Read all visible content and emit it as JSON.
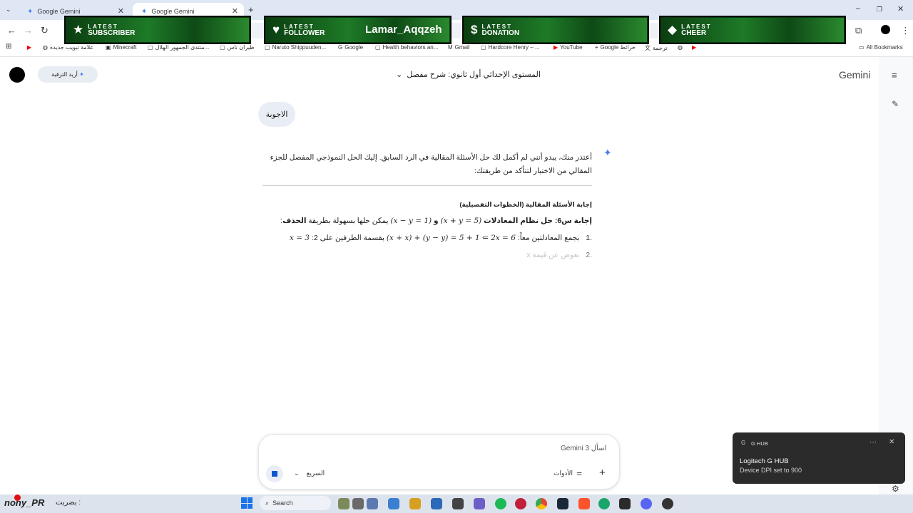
{
  "browser": {
    "tabs": [
      {
        "label": "Google Gemini",
        "active": false
      },
      {
        "label": "Google Gemini",
        "active": true
      }
    ],
    "new_tab": "+",
    "window_controls": [
      "–",
      "❐",
      "✕"
    ],
    "bookmarks": [
      {
        "icon": "youtube-icon",
        "label": ""
      },
      {
        "icon": "link-icon",
        "label": "علامة تبويب جديدة"
      },
      {
        "icon": "minecraft-icon",
        "label": "Minecraft"
      },
      {
        "icon": "page-icon",
        "label": "منتدى الجمهور الهلال..."
      },
      {
        "icon": "page-icon",
        "label": "طيران ناس"
      },
      {
        "icon": "page-icon",
        "label": "Naruto Shippuuden..."
      },
      {
        "icon": "google-icon",
        "label": "Google"
      },
      {
        "icon": "page-icon",
        "label": "Health behaviors an..."
      },
      {
        "icon": "gmail-icon",
        "label": "Gmail"
      },
      {
        "icon": "page-icon",
        "label": "Hardcore Henry – ..."
      },
      {
        "icon": "youtube-icon",
        "label": "YouTube"
      },
      {
        "icon": "maps-icon",
        "label": "Google خرائط"
      },
      {
        "icon": "translate-icon",
        "label": "ترجمة"
      },
      {
        "icon": "globe-icon",
        "label": ""
      },
      {
        "icon": "youtube-icon",
        "label": ""
      }
    ],
    "all_bookmarks": "All Bookmarks"
  },
  "stream_overlay": [
    {
      "line1": "LATEST",
      "line2": "SUBSCRIBER",
      "icon": "star-icon",
      "name": ""
    },
    {
      "line1": "LATEST",
      "line2": "FOLLOWER",
      "icon": "heart-icon",
      "name": "Lamar_Aqqzeh"
    },
    {
      "line1": "LATEST",
      "line2": "DONATION",
      "icon": "dollar-icon",
      "name": ""
    },
    {
      "line1": "LATEST",
      "line2": "CHEER",
      "icon": "diamond-icon",
      "name": ""
    }
  ],
  "gemini": {
    "brand": "Gemini",
    "conversation_title": "المستوى الإحداثي أول ثانوي: شرح مفصل",
    "upgrade_label": "أريد الترقية",
    "user_message": "الاجوبة",
    "response": {
      "intro": "أعتذر منك، يبدو أنني لم أكمل لك حل الأسئلة المقالية في الرد السابق. إليك الحل النموذجي المفصل للجزء المقالي من الاختبار لتتأكد من طريقتك:",
      "section_title": "إجابة الأسئلة المقالية (الخطوات التفصيلية)",
      "q6_prefix": "إجابة س6: حل نظام المعادلات",
      "eq1": "(x + y = 5)",
      "and": "و",
      "eq2": "(x − y = 1)",
      "q6_suffix": "يمكن حلها بسهولة بطريقة",
      "method": "الحذف",
      "colon": ":",
      "step1_num": ".1",
      "step1_text": "بجمع المعادلتين معاً:",
      "step1_math_a": "(x + x) + (y − y) = 5 + 1 ⇐ 2x = 6",
      "step1_text2": "بقسمة الطرفين على 2:",
      "step1_math_b": "x = 3",
      "step2_num": ".2",
      "step2_text": "نعوض عن قيمة x"
    },
    "input": {
      "placeholder": "اسأل Gemini 3",
      "model": "السريع",
      "tools": "الأدوات",
      "plus": "+"
    }
  },
  "toast": {
    "app": "G HUB",
    "title": "Logitech G HUB",
    "body": "Device DPI set to 900",
    "more": "···",
    "close": "✕"
  },
  "taskbar": {
    "user": "nony_PR",
    "user_suffix": "بضربت :",
    "search": "Search"
  }
}
